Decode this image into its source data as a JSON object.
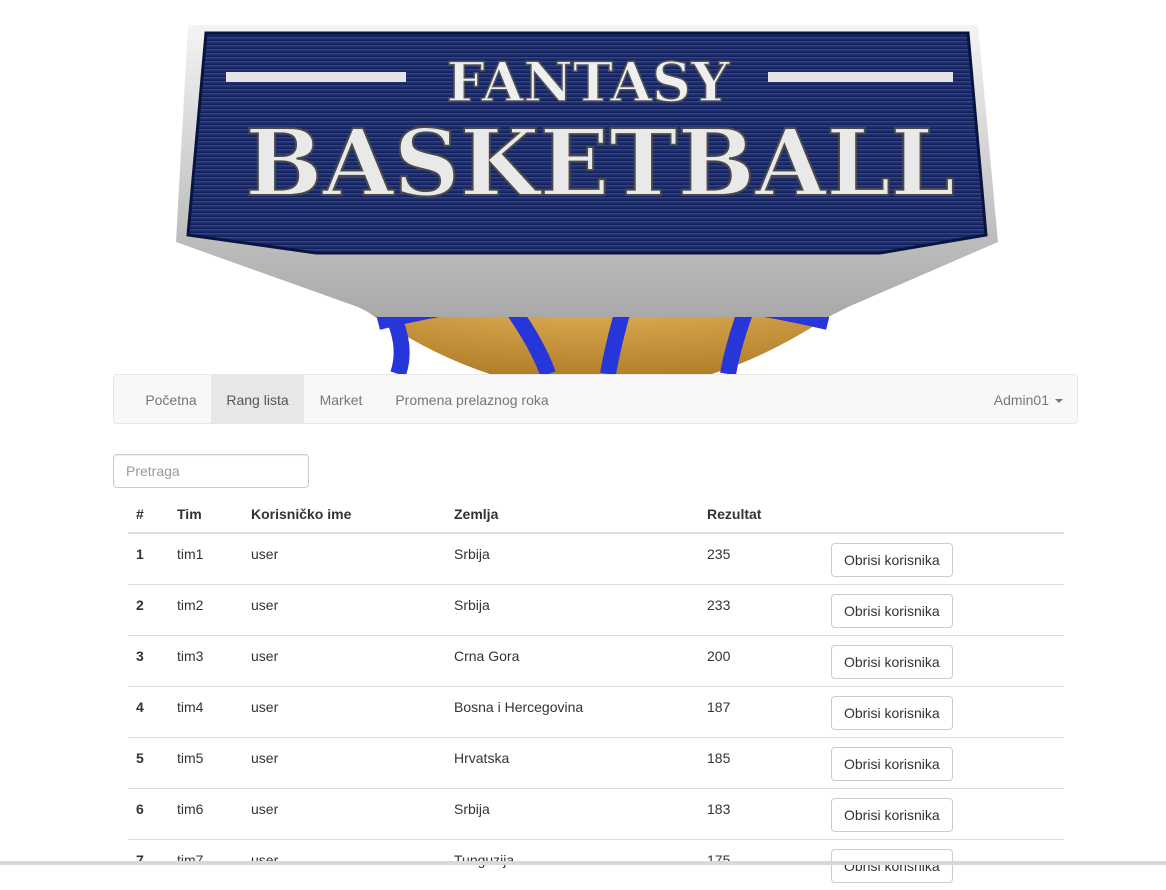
{
  "banner": {
    "line1": "FANTASY",
    "line2": "BASKETBALL"
  },
  "nav": {
    "items": [
      {
        "label": "Početna",
        "active": false
      },
      {
        "label": "Rang lista",
        "active": true
      },
      {
        "label": "Market",
        "active": false
      },
      {
        "label": "Promena prelaznog roka",
        "active": false
      }
    ],
    "user": "Admin01"
  },
  "search": {
    "placeholder": "Pretraga",
    "value": ""
  },
  "table": {
    "headers": [
      "#",
      "Tim",
      "Korisničko ime",
      "Zemlja",
      "Rezultat",
      ""
    ],
    "button_label": "Obrisi korisnika",
    "rows": [
      {
        "rank": "1",
        "team": "tim1",
        "username": "user",
        "country": "Srbija",
        "score": "235"
      },
      {
        "rank": "2",
        "team": "tim2",
        "username": "user",
        "country": "Srbija",
        "score": "233"
      },
      {
        "rank": "3",
        "team": "tim3",
        "username": "user",
        "country": "Crna Gora",
        "score": "200"
      },
      {
        "rank": "4",
        "team": "tim4",
        "username": "user",
        "country": "Bosna i Hercegovina",
        "score": "187"
      },
      {
        "rank": "5",
        "team": "tim5",
        "username": "user",
        "country": "Hrvatska",
        "score": "185"
      },
      {
        "rank": "6",
        "team": "tim6",
        "username": "user",
        "country": "Srbija",
        "score": "183"
      },
      {
        "rank": "7",
        "team": "tim7",
        "username": "user",
        "country": "Tunguzija",
        "score": "175"
      }
    ]
  },
  "colors": {
    "navy": "#17286b",
    "blue": "#2a3fd6",
    "orange": "#d9a33b",
    "silver": "#e8e8e8"
  }
}
